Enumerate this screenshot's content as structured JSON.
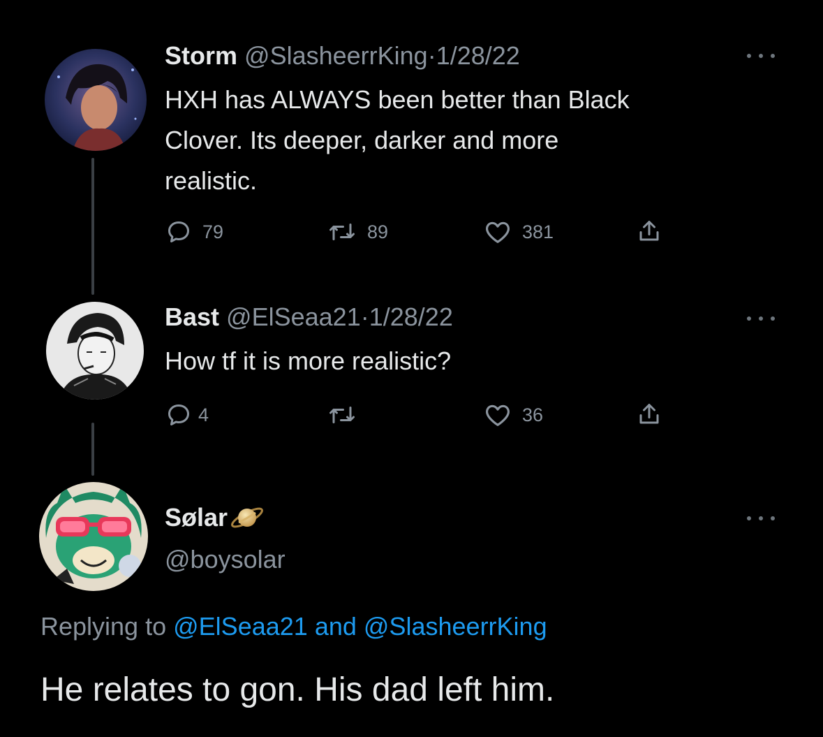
{
  "tweets": [
    {
      "name": "Storm",
      "handle": "@SlasheerrKing",
      "sep": "·",
      "date": "1/28/22",
      "text_lines": [
        "HXH has ALWAYS been better than Black",
        "Clover. Its deeper, darker and more",
        "realistic."
      ],
      "replies": "79",
      "retweets": "89",
      "likes": "381"
    },
    {
      "name": "Bast",
      "handle": "@ElSeaa21",
      "sep": "·",
      "date": "1/28/22",
      "text_lines": [
        "How tf it is more realistic?"
      ],
      "replies": "4",
      "retweets": "",
      "likes": "36"
    }
  ],
  "main_tweet": {
    "name": "Sølar",
    "name_badge_icon": "saturn-emoji",
    "handle": "@boysolar",
    "replying_prefix": "Replying to",
    "replying_mention_1": "@ElSeaa21",
    "replying_and": "and",
    "replying_mention_2": "@SlasheerrKing",
    "text": "He relates to gon. His dad left him."
  },
  "icons": {
    "reply": "reply-icon",
    "retweet": "retweet-icon",
    "like": "heart-icon",
    "share": "share-icon",
    "more": "more-icon"
  },
  "colors": {
    "background": "#000000",
    "text": "#e7e9ea",
    "secondary": "#8b949e",
    "accent": "#1d9bf0",
    "thread_line": "#3a3f44"
  }
}
